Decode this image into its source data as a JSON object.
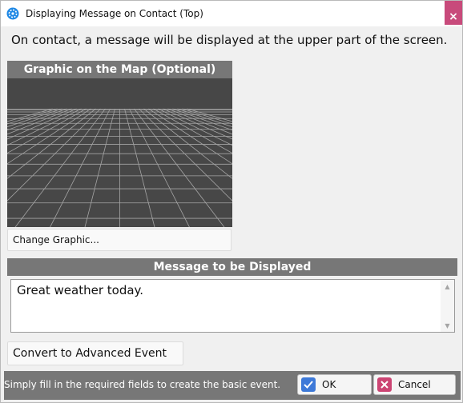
{
  "window": {
    "title": "Displaying Message on Contact (Top)",
    "app_icon": "app-gear-icon",
    "close_label": "×"
  },
  "description": "On contact, a message will be displayed at the upper part of the screen.",
  "graphic": {
    "header": "Graphic on the Map (Optional)",
    "change_button": "Change Graphic..."
  },
  "message": {
    "header": "Message to be Displayed",
    "value": "Great weather today."
  },
  "convert_button": "Convert to Advanced Event",
  "footer": {
    "hint": "Simply fill in the required fields to create the basic event.",
    "ok_label": "OK",
    "cancel_label": "Cancel"
  },
  "colors": {
    "section_header": "#777777",
    "close_button": "#c84a7b",
    "ok_icon": "#3d79d8",
    "cancel_icon": "#cc4473"
  }
}
